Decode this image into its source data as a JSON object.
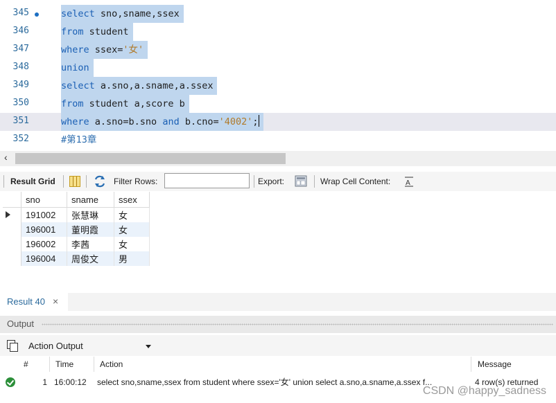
{
  "editor": {
    "lines": [
      {
        "num": "345",
        "code": "select sno,sname,ssex"
      },
      {
        "num": "346",
        "code": "from student"
      },
      {
        "num": "347",
        "code": "where ssex='女'"
      },
      {
        "num": "348",
        "code": "union"
      },
      {
        "num": "349",
        "code": "select a.sno,a.sname,a.ssex"
      },
      {
        "num": "350",
        "code": "from student a,score b"
      },
      {
        "num": "351",
        "code": "where a.sno=b.sno and b.cno='4002';"
      },
      {
        "num": "352",
        "code": "#第13章"
      }
    ],
    "colors": {
      "keyword": "#1a5fb4",
      "string": "#b07a2a",
      "selection": "#bfd6ee"
    }
  },
  "result_toolbar": {
    "result_grid": "Result Grid",
    "filter_rows": "Filter Rows:",
    "filter_value": "",
    "export": "Export:",
    "wrap_cell": "Wrap Cell Content:",
    "icons": [
      "form-editor-icon",
      "refresh-icon",
      "export-icon",
      "wrap-icon"
    ]
  },
  "result_grid": {
    "columns": [
      "sno",
      "sname",
      "ssex"
    ],
    "rows": [
      [
        "191002",
        "张慧琳",
        "女"
      ],
      [
        "196001",
        "董明霞",
        "女"
      ],
      [
        "196002",
        "李茜",
        "女"
      ],
      [
        "196004",
        "周俊文",
        "男"
      ]
    ]
  },
  "result_tab": {
    "label": "Result 40",
    "close": "×"
  },
  "output": {
    "title": "Output",
    "selector": "Action Output",
    "columns": [
      "#",
      "Time",
      "Action",
      "Message"
    ],
    "rows": [
      {
        "n": "1",
        "time": "16:00:12",
        "action": "select sno,sname,ssex from student where ssex='女' union select a.sno,a.sname,a.ssex f...",
        "message": "4 row(s) returned"
      }
    ]
  },
  "watermark": "CSDN @happy_sadness"
}
